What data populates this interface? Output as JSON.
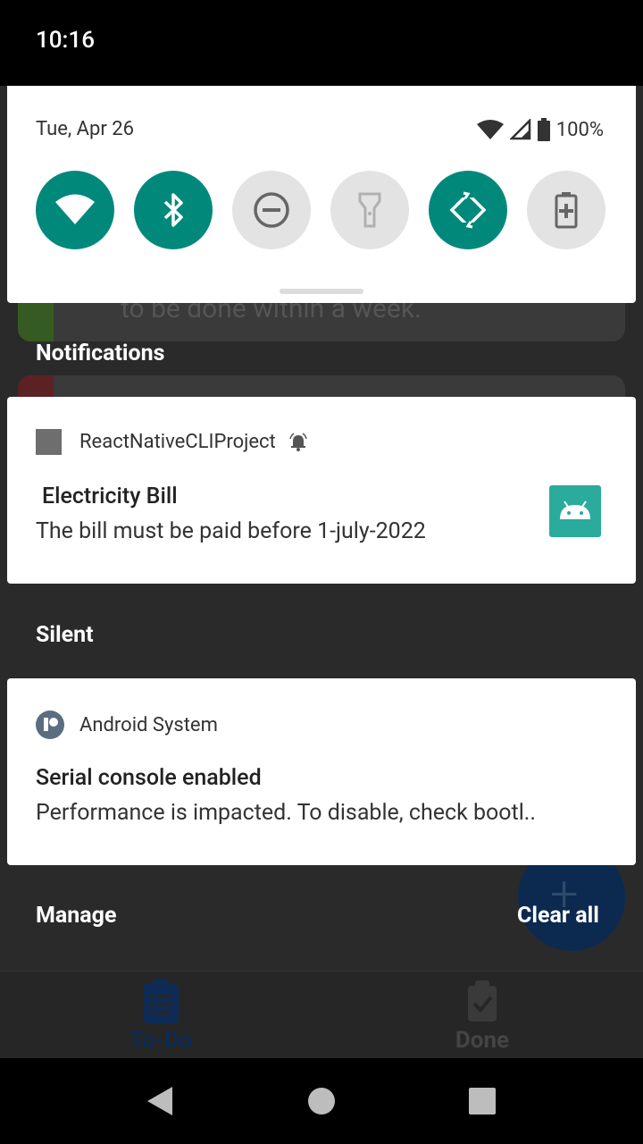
{
  "status_bar": {
    "time": "10:16"
  },
  "background_app": {
    "card_text": "to be done within a week.",
    "fab_icon": "plus-icon",
    "tabs": [
      {
        "label": "To-Do",
        "icon": "clipboard-list-icon"
      },
      {
        "label": "Done",
        "icon": "clipboard-check-icon"
      }
    ]
  },
  "quick_settings": {
    "date": "Tue, Apr 26",
    "battery_percent": "100%",
    "tiles": [
      {
        "name": "wifi",
        "icon": "wifi-icon",
        "state": "on"
      },
      {
        "name": "bluetooth",
        "icon": "bluetooth-icon",
        "state": "on"
      },
      {
        "name": "do-not-disturb",
        "icon": "do-not-disturb-icon",
        "state": "off"
      },
      {
        "name": "flashlight",
        "icon": "flashlight-icon",
        "state": "off"
      },
      {
        "name": "auto-rotate",
        "icon": "auto-rotate-icon",
        "state": "on"
      },
      {
        "name": "battery-saver",
        "icon": "battery-saver-icon",
        "state": "off"
      }
    ],
    "accent_color": "#00897b"
  },
  "sections": {
    "notifications": "Notifications",
    "silent": "Silent"
  },
  "notifications": [
    {
      "app_name": "ReactNativeCLIProject",
      "title": "Electricity Bill",
      "body": "The bill must be paid before 1-july-2022"
    },
    {
      "app_name": "Android System",
      "title": "Serial console enabled",
      "body": "Performance is impacted. To disable, check bootl.."
    }
  ],
  "footer": {
    "manage": "Manage",
    "clear_all": "Clear all"
  }
}
